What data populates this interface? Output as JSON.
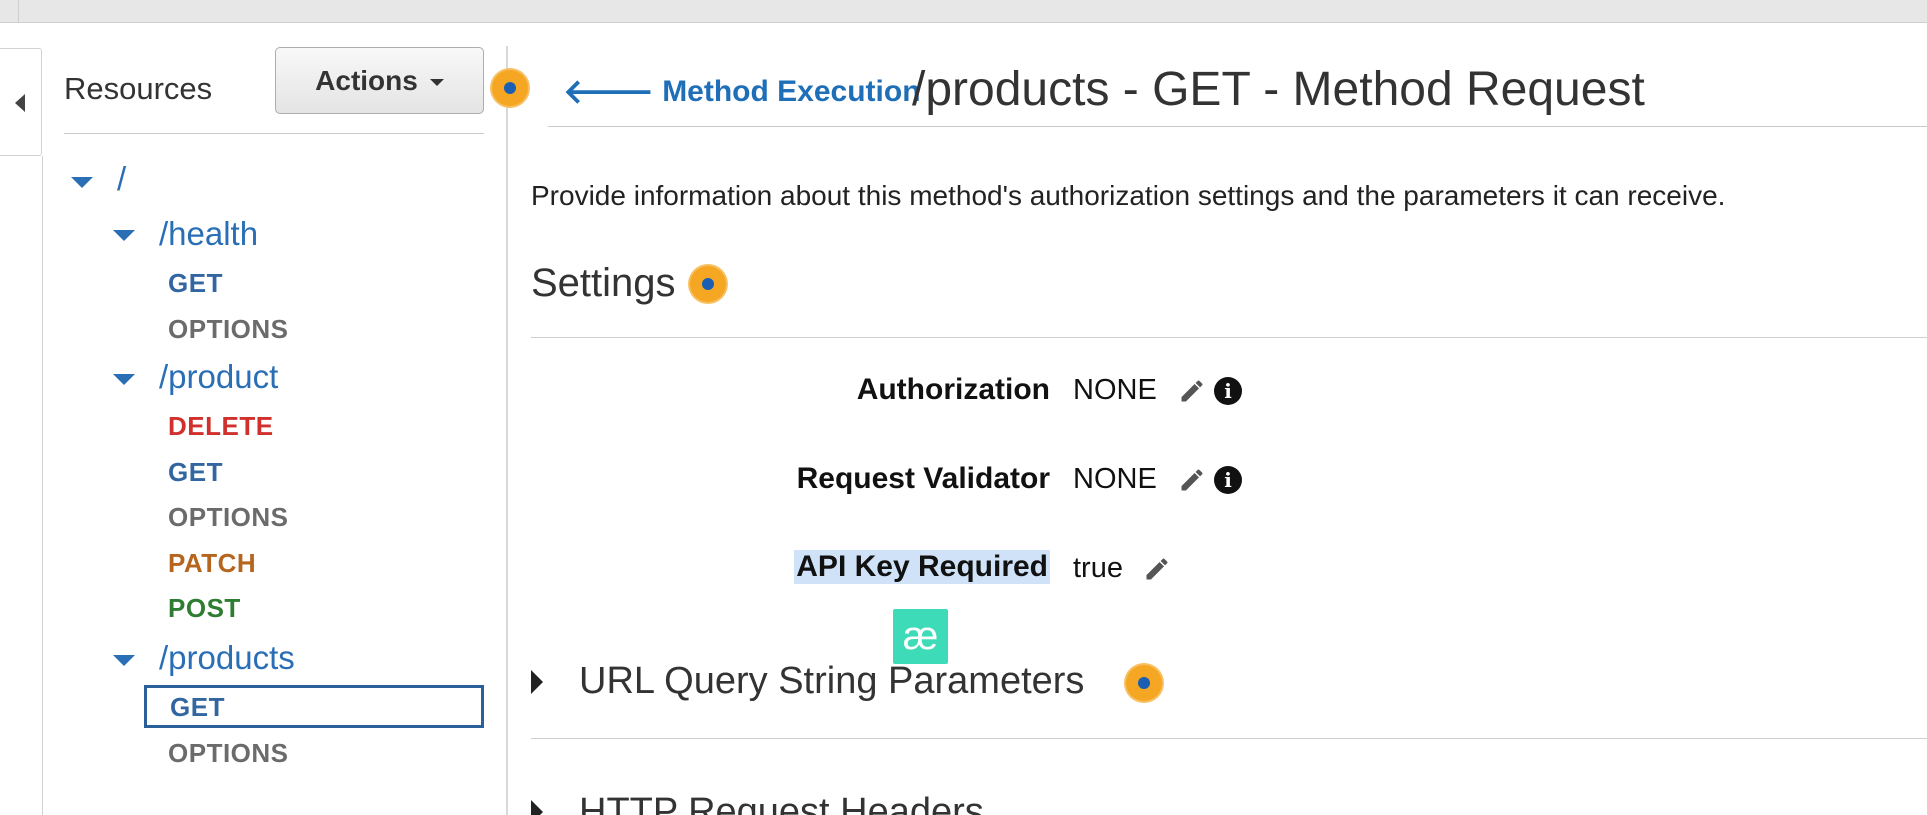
{
  "sidebar": {
    "title": "Resources",
    "actions_label": "Actions",
    "tree": [
      {
        "path": "/",
        "methods": []
      },
      {
        "path": "/health",
        "methods": [
          "GET",
          "OPTIONS"
        ]
      },
      {
        "path": "/product",
        "methods": [
          "DELETE",
          "GET",
          "OPTIONS",
          "PATCH",
          "POST"
        ]
      },
      {
        "path": "/products",
        "methods": [
          "GET",
          "OPTIONS"
        ]
      }
    ],
    "selected": "/products GET"
  },
  "header": {
    "back_label": "Method Execution",
    "title": "/products - GET - Method Request"
  },
  "main": {
    "description": "Provide information about this method's authorization settings and the parameters it can receive.",
    "settings_title": "Settings",
    "settings": [
      {
        "label": "Authorization",
        "value": "NONE"
      },
      {
        "label": "Request Validator",
        "value": "NONE"
      },
      {
        "label": "API Key Required",
        "value": "true"
      }
    ],
    "sections": [
      "URL Query String Parameters",
      "HTTP Request Headers"
    ]
  },
  "badge": {
    "glyph": "æ",
    "color": "#3ddbb8"
  },
  "colors": {
    "link": "#2a6fb6",
    "get": "#3366a0",
    "options": "#6b6b6b",
    "delete": "#d0312d",
    "patch": "#b5651d",
    "post": "#2e7d32",
    "help": "#f5a623"
  }
}
